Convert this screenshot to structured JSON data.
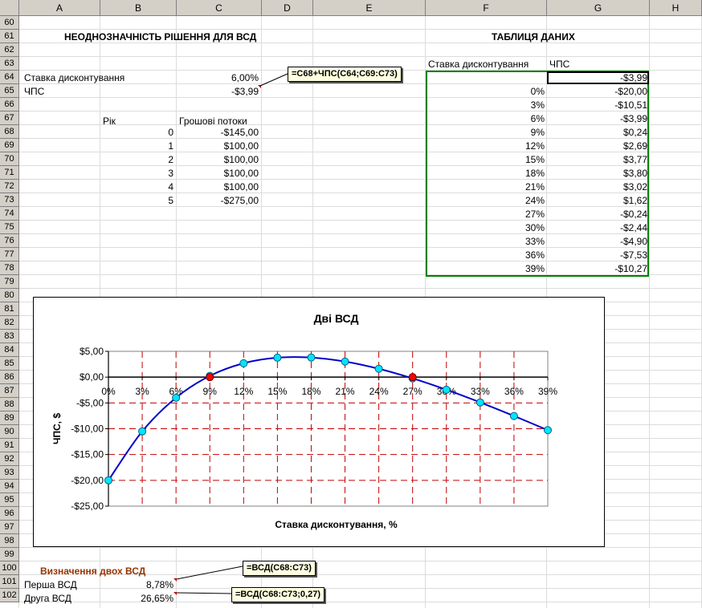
{
  "columns": [
    "A",
    "B",
    "C",
    "D",
    "E",
    "F",
    "G",
    "H"
  ],
  "rows": [
    "60",
    "61",
    "62",
    "63",
    "64",
    "65",
    "66",
    "67",
    "68",
    "69",
    "70",
    "71",
    "72",
    "73",
    "74",
    "75",
    "76",
    "77",
    "78",
    "79",
    "80",
    "81",
    "82",
    "83",
    "84",
    "85",
    "86",
    "87",
    "88",
    "89",
    "90",
    "91",
    "92",
    "93",
    "94",
    "95",
    "96",
    "97",
    "98",
    "99",
    "100",
    "101",
    "102"
  ],
  "left": {
    "title": "НЕОДНОЗНАЧНІСТЬ РІШЕННЯ ДЛЯ ВСД",
    "rate_label": "Ставка дисконтування",
    "rate_value": "6,00%",
    "npv_label": "ЧПС",
    "npv_value": "-$3,99",
    "year_header": "Рік",
    "cf_header": "Грошові потоки",
    "years": [
      "0",
      "1",
      "2",
      "3",
      "4",
      "5"
    ],
    "cash_flows": [
      "-$145,00",
      "$100,00",
      "$100,00",
      "$100,00",
      "$100,00",
      "-$275,00"
    ],
    "npv_formula": "=C68+ЧПС(C64;C69:C73)"
  },
  "table": {
    "title": "ТАБЛИЦЯ ДАНИХ",
    "rate_header": "Ставка дисконтування",
    "npv_header": "ЧПС",
    "top_value": "-$3,99",
    "rates": [
      "0%",
      "3%",
      "6%",
      "9%",
      "12%",
      "15%",
      "18%",
      "21%",
      "24%",
      "27%",
      "30%",
      "33%",
      "36%",
      "39%"
    ],
    "npvs": [
      "-$20,00",
      "-$10,51",
      "-$3,99",
      "$0,24",
      "$2,69",
      "$3,77",
      "$3,80",
      "$3,02",
      "$1,62",
      "-$0,24",
      "-$2,44",
      "-$4,90",
      "-$7,53",
      "-$10,27"
    ]
  },
  "chart_data": {
    "type": "line",
    "title": "Дві ВСД",
    "xlabel": "Ставка дисконтування, %",
    "ylabel": "ЧПС, $",
    "categories": [
      "0%",
      "3%",
      "6%",
      "9%",
      "12%",
      "15%",
      "18%",
      "21%",
      "24%",
      "27%",
      "30%",
      "33%",
      "36%",
      "39%"
    ],
    "x": [
      0,
      3,
      6,
      9,
      12,
      15,
      18,
      21,
      24,
      27,
      30,
      33,
      36,
      39
    ],
    "values": [
      -20.0,
      -10.51,
      -3.99,
      0.24,
      2.69,
      3.77,
      3.8,
      3.02,
      1.62,
      -0.24,
      -2.44,
      -4.9,
      -7.53,
      -10.27
    ],
    "y_ticks": [
      "$5,00",
      "$0,00",
      "-$5,00",
      "-$10,00",
      "-$15,00",
      "-$20,00",
      "-$25,00"
    ],
    "ylim": [
      -25,
      5
    ],
    "grid": true,
    "highlight_points": [
      9,
      27
    ],
    "colors": {
      "line": "#0000cc",
      "marker": "#00e5ff",
      "highlight": "#ff0000",
      "grid": "#c00000"
    }
  },
  "bottom": {
    "title": "Визначення двох ВСД",
    "first_label": "Перша ВСД",
    "first_value": "8,78%",
    "second_label": "Друга ВСД",
    "second_value": "26,65%",
    "formula1": "=ВСД(C68:C73)",
    "formula2": "=ВСД(C68:C73;0,27)"
  },
  "colors": {
    "title_brown": "#993300",
    "table_border": "#008000",
    "header_bg": "#d4d0c8"
  }
}
